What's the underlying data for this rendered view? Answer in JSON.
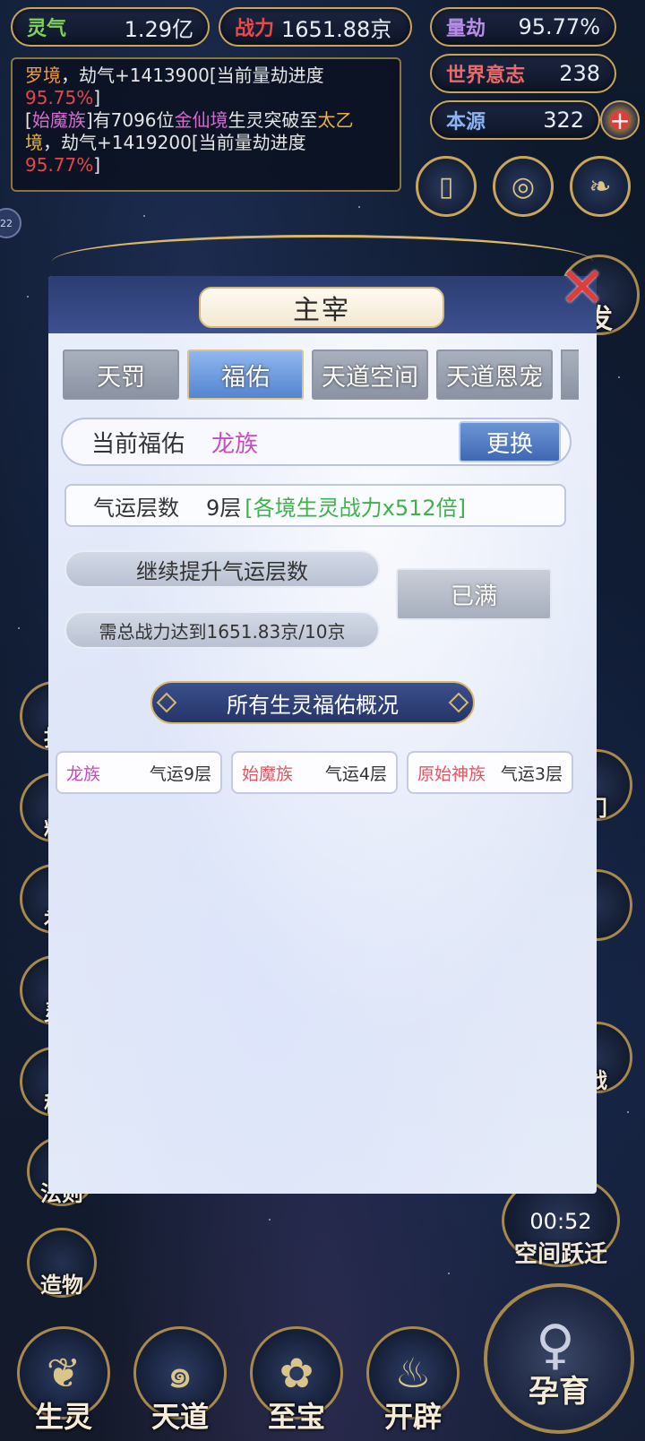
{
  "top_stats": {
    "lingqi": {
      "label": "灵气",
      "value": "1.29亿"
    },
    "zhanli": {
      "label": "战力",
      "value": "1651.88京"
    },
    "liangjie": {
      "label": "量劫",
      "value": "95.77%"
    },
    "shijie": {
      "label": "世界意志",
      "value": "238"
    },
    "benyuan": {
      "label": "本源",
      "value": "322"
    }
  },
  "log": {
    "line1_a": "罗境",
    "line1_b": "，劫气+1413900[当前量劫进度",
    "line1_c": "95.75%",
    "line1_d": "]",
    "line2_a": "[",
    "line2_b": "始魔族",
    "line2_c": "]有7096位",
    "line2_d": "金仙境",
    "line2_e": "生灵突破至",
    "line2_f": "太乙境",
    "line2_g": "，劫气+1419200[当前量劫进度",
    "line2_h": "95.77%",
    "line2_i": "]"
  },
  "right_side": {
    "fa_label": "发",
    "men_label": "门",
    "zhan_label": "战",
    "timer": "00:52",
    "space_jump": "空间跃迁",
    "yunyu": "孕育"
  },
  "left_side": {
    "items": [
      "扣",
      "料",
      "补",
      "灵",
      "秘",
      "法则",
      "造物"
    ]
  },
  "bottom_nav": [
    "生灵",
    "天道",
    "至宝",
    "开辟"
  ],
  "modal": {
    "title": "主宰",
    "tabs": [
      "天罚",
      "福佑",
      "天道空间",
      "天道恩宠"
    ],
    "current_blessing_label": "当前福佑",
    "current_blessing_value": "龙族",
    "change_button": "更换",
    "luck_label": "气运层数",
    "luck_value": "9层",
    "luck_bonus": "[各境生灵战力x512倍]",
    "continue_label": "继续提升气运层数",
    "requirement": "需总战力达到1651.83京/10京",
    "full_button": "已满",
    "overview_title": "所有生灵福佑概况",
    "races": [
      {
        "name": "龙族",
        "luck": "气运9层"
      },
      {
        "name": "始魔族",
        "luck": "气运4层"
      },
      {
        "name": "原始神族",
        "luck": "气运3层"
      }
    ]
  },
  "small_badge": "22",
  "colors": {
    "gold_border": "#c9a55a",
    "tab_active": "#5585d0",
    "purple_text": "#c94ac4",
    "green_text": "#3bb34a",
    "close_red": "#e23b3b"
  }
}
